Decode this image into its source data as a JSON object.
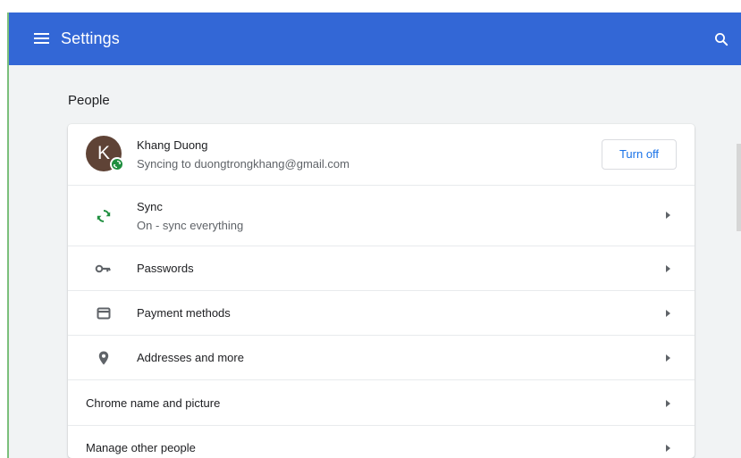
{
  "app": {
    "title": "Settings"
  },
  "theme": {
    "toolbar_color": "#3367d6",
    "background_color": "#f1f3f4",
    "card_color": "#ffffff",
    "accent_color": "#1a73e8",
    "sync_color": "#1e8e3e"
  },
  "icons": {
    "menu": "hamburger-icon",
    "search": "search-icon",
    "sync": "sync-icon",
    "passwords": "key-icon",
    "payment": "credit-card-icon",
    "addresses": "location-pin-icon",
    "arrow": "chevron-right-icon"
  },
  "people": {
    "section_title": "People",
    "account": {
      "avatar_letter": "K",
      "name": "Khang Duong",
      "status": "Syncing to duongtrongkhang@gmail.com",
      "turn_off_label": "Turn off"
    },
    "items": [
      {
        "title": "Sync",
        "subtitle": "On - sync everything"
      },
      {
        "title": "Passwords"
      },
      {
        "title": "Payment methods"
      },
      {
        "title": "Addresses and more"
      },
      {
        "title": "Chrome name and picture"
      },
      {
        "title": "Manage other people"
      }
    ]
  }
}
